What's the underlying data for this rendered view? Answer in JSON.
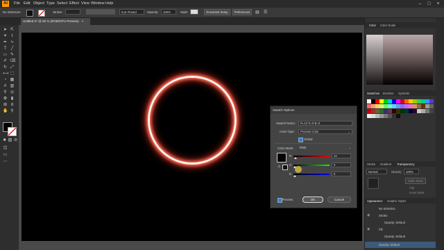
{
  "menubar": {
    "items": [
      "File",
      "Edit",
      "Object",
      "Type",
      "Select",
      "Effect",
      "View",
      "Window",
      "Help"
    ],
    "logo": "Ai"
  },
  "control_bar": {
    "selection": "No Selection",
    "stroke_label": "Stroke:",
    "stroke_value": "",
    "brush": "5 pt. Round",
    "opacity_label": "Opacity:",
    "opacity_value": "100%",
    "style_label": "Style:",
    "document_setup": "Document Setup",
    "preferences": "Preferences"
  },
  "document_tab": {
    "title": "Untitled-2* @ 50 % (RGB/GPU Preview)",
    "close": "×"
  },
  "swatch_dialog": {
    "title": "Swatch Options",
    "swatch_name_label": "Swatch Name:",
    "swatch_name_value": "R=12 G=0 B=0",
    "color_type_label": "Color Type:",
    "color_type_value": "Process Color",
    "global_label": "Global",
    "color_mode_label": "Color Mode:",
    "color_mode_value": "RGB",
    "r_label": "R",
    "g_label": "G",
    "b_label": "B",
    "r_value": "12",
    "g_value": "0",
    "b_value": "0",
    "preview_label": "Preview",
    "ok": "OK",
    "cancel": "Cancel"
  },
  "panels": {
    "color_tab": "Color",
    "color_guide_tab": "Color Guide",
    "swatches_tab": "Swatches",
    "brushes_tab": "Brushes",
    "symbols_tab": "Symbols",
    "stroke_tab": "Stroke",
    "gradient_tab": "Gradient",
    "transparency_tab": "Transparency",
    "blend_mode": "Normal",
    "opacity_label": "Opacity:",
    "opacity_value": "100%",
    "make_mask": "Make Mask",
    "clip": "Clip",
    "invert_mask": "Invert Mask",
    "appearance_tab": "Appearance",
    "graphic_styles_tab": "Graphic Styles",
    "no_selection": "No Selection",
    "stroke_row": "Stroke:",
    "opacity_row_1": "Opacity: Default",
    "fill_row": "Fill:",
    "opacity_row_2": "Opacity: Default",
    "opacity_row_3": "Opacity: Default"
  },
  "colors": {
    "accent": "#ff9a00",
    "ring_glow": "#ff4a3a",
    "artboard": "#000000"
  }
}
